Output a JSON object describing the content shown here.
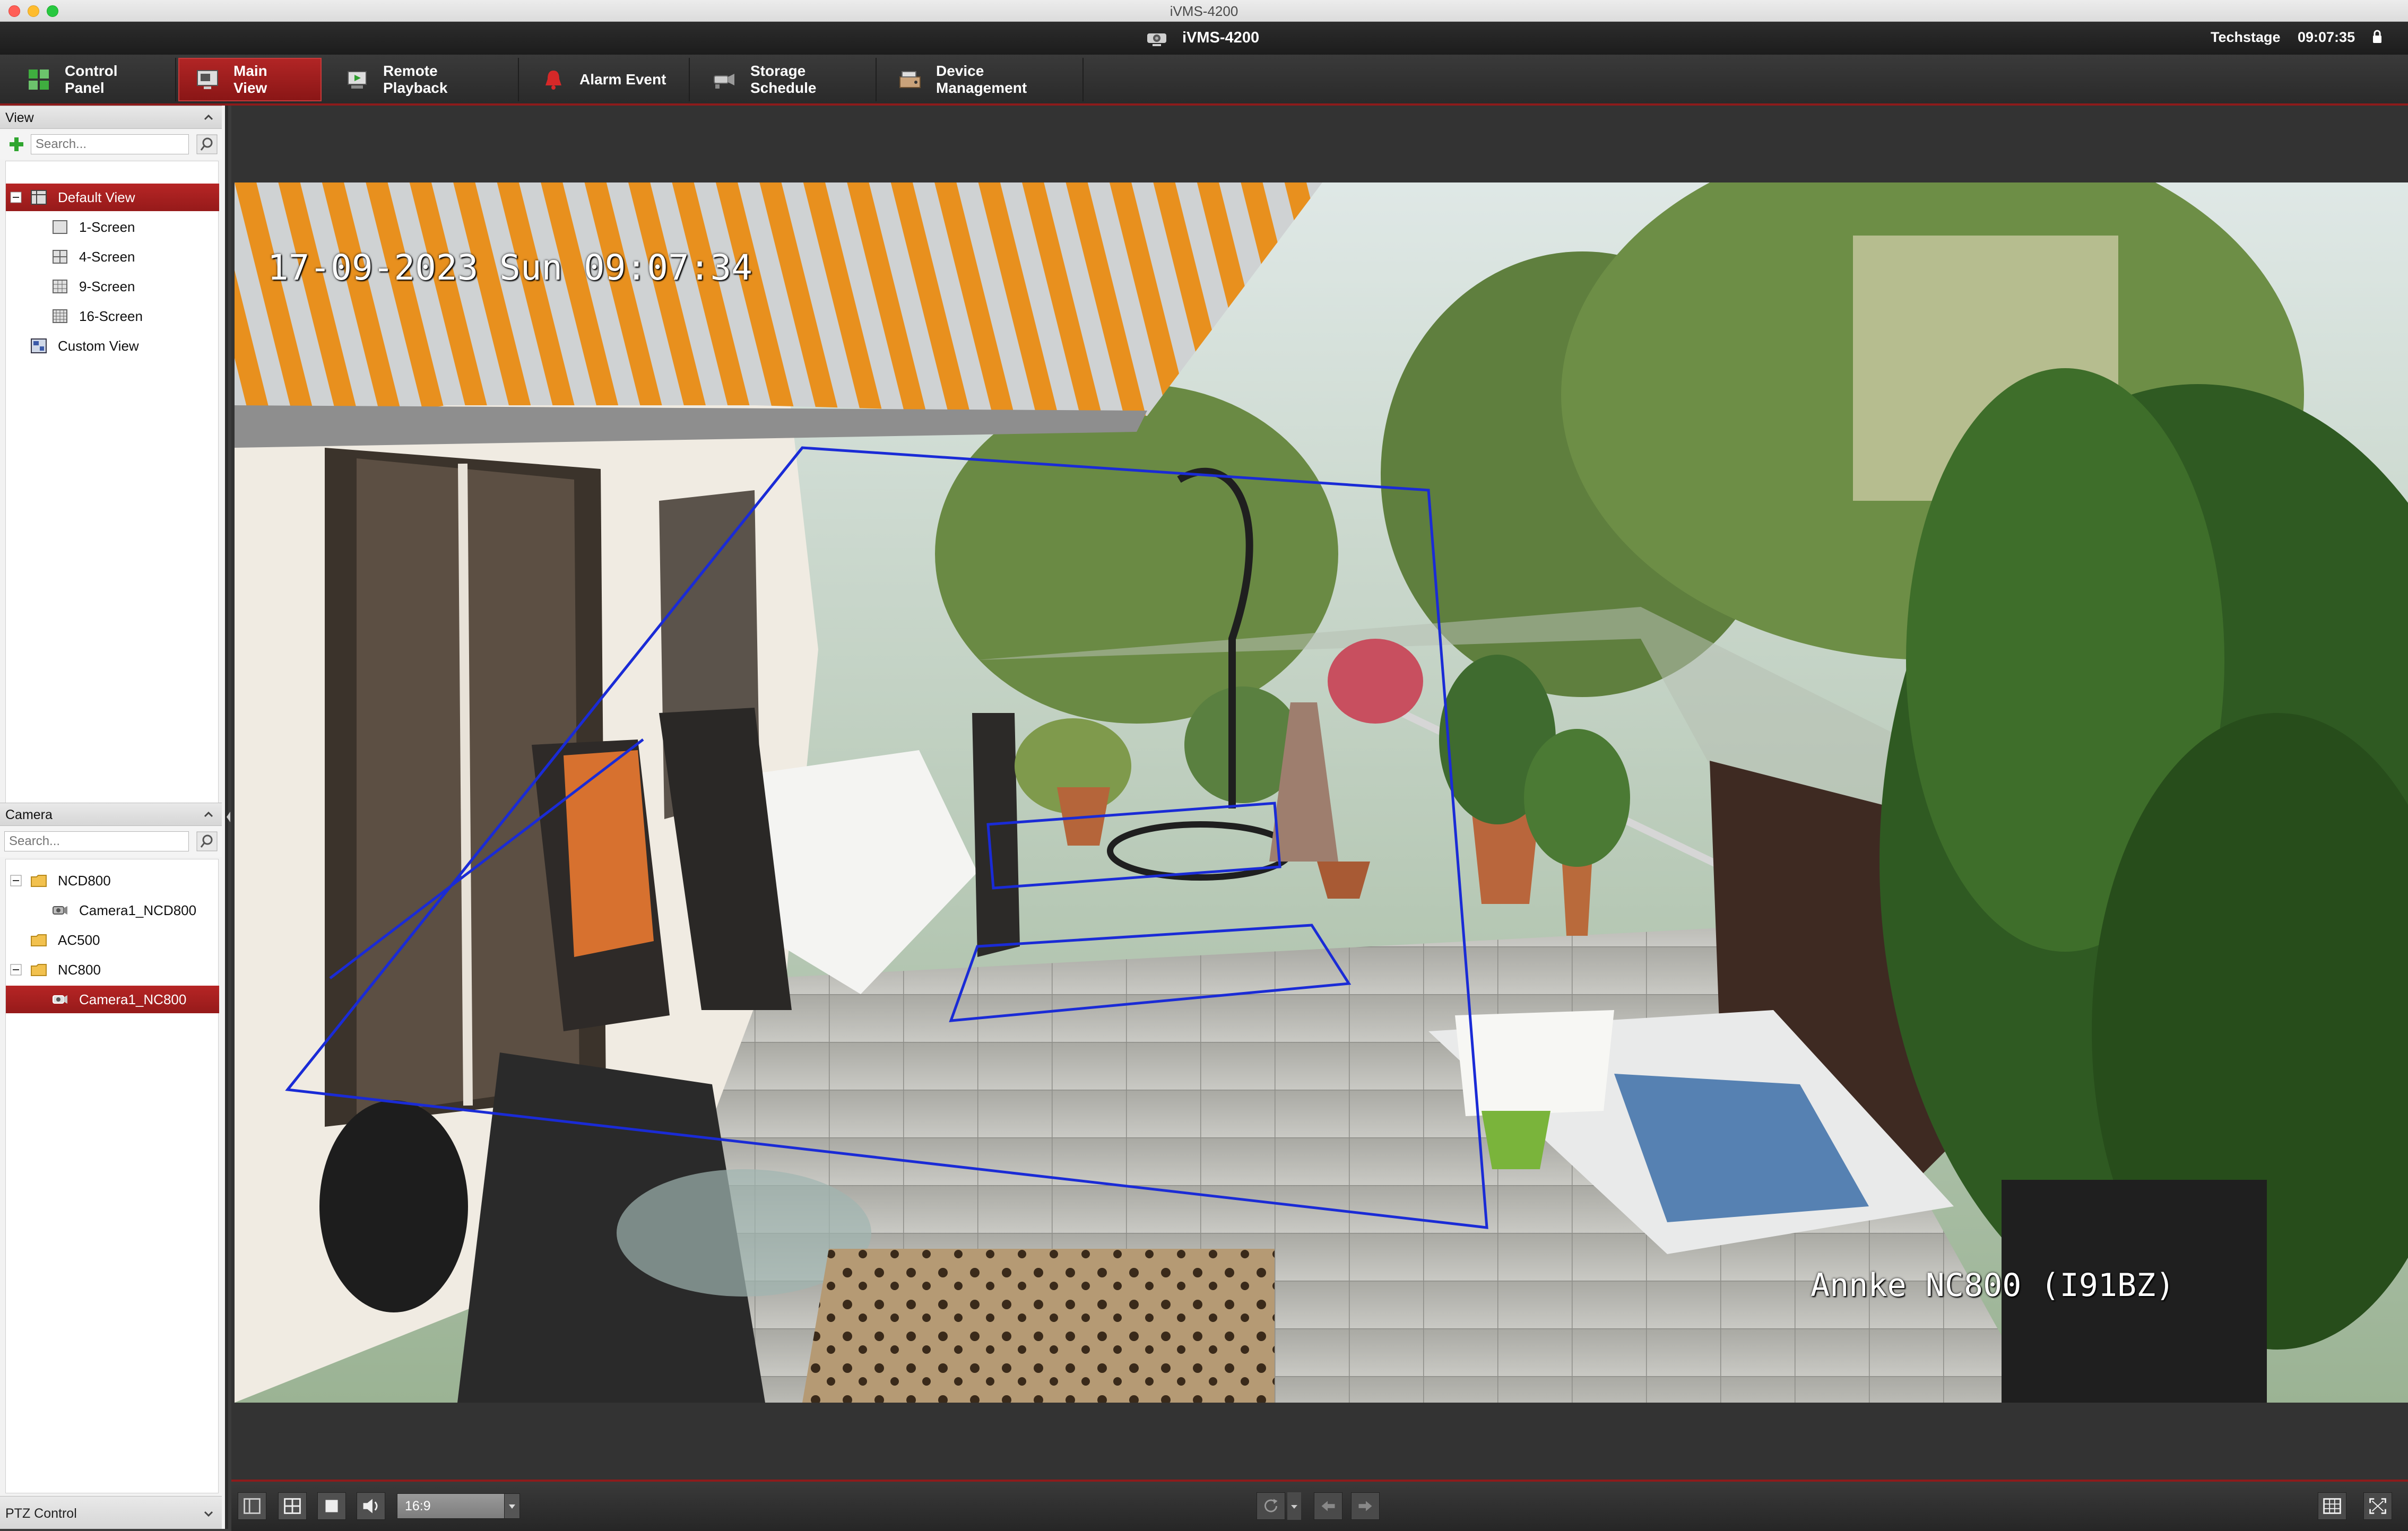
{
  "window": {
    "os_title": "iVMS-4200"
  },
  "header": {
    "app_name": "iVMS-4200",
    "user": "Techstage",
    "time": "09:07:35"
  },
  "tabs": [
    {
      "label": "Control Panel",
      "icon": "grid-squares-icon",
      "active": false
    },
    {
      "label": "Main View",
      "icon": "monitor-camera-icon",
      "active": true
    },
    {
      "label": "Remote Playback",
      "icon": "playback-icon",
      "active": false
    },
    {
      "label": "Alarm Event",
      "icon": "alarm-bell-icon",
      "active": false
    },
    {
      "label": "Storage Schedule",
      "icon": "storage-camera-icon",
      "active": false
    },
    {
      "label": "Device Management",
      "icon": "device-dvr-icon",
      "active": false
    }
  ],
  "view_panel": {
    "title": "View",
    "search_placeholder": "Search...",
    "tree": [
      {
        "label": "Default View",
        "level": 0,
        "selected": true,
        "icon": "view-group-icon"
      },
      {
        "label": "1-Screen",
        "level": 1,
        "icon": "layout-1-icon"
      },
      {
        "label": "4-Screen",
        "level": 1,
        "icon": "layout-4-icon"
      },
      {
        "label": "9-Screen",
        "level": 1,
        "icon": "layout-9-icon"
      },
      {
        "label": "16-Screen",
        "level": 1,
        "icon": "layout-16-icon"
      },
      {
        "label": "Custom View",
        "level": 0,
        "icon": "custom-view-icon"
      }
    ]
  },
  "camera_panel": {
    "title": "Camera",
    "search_placeholder": "Search...",
    "tree": [
      {
        "label": "NCD800",
        "level": 0,
        "type": "folder"
      },
      {
        "label": "Camera1_NCD800",
        "level": 1,
        "type": "camera"
      },
      {
        "label": "AC500",
        "level": 0,
        "type": "folder"
      },
      {
        "label": "NC800",
        "level": 0,
        "type": "folder"
      },
      {
        "label": "Camera1_NC800",
        "level": 1,
        "type": "camera",
        "selected": true
      }
    ]
  },
  "ptz": {
    "label": "PTZ Control"
  },
  "video": {
    "timestamp": "17-09-2023 Sun 09:07:34",
    "camera_label": "Annke NC800 (I91BZ)"
  },
  "bottom_bar": {
    "aspect_ratio": "16:9"
  },
  "colors": {
    "accent": "#a31f1f",
    "header_bg": "#1c1c1c",
    "zone_lines": "#1a2bd6"
  }
}
